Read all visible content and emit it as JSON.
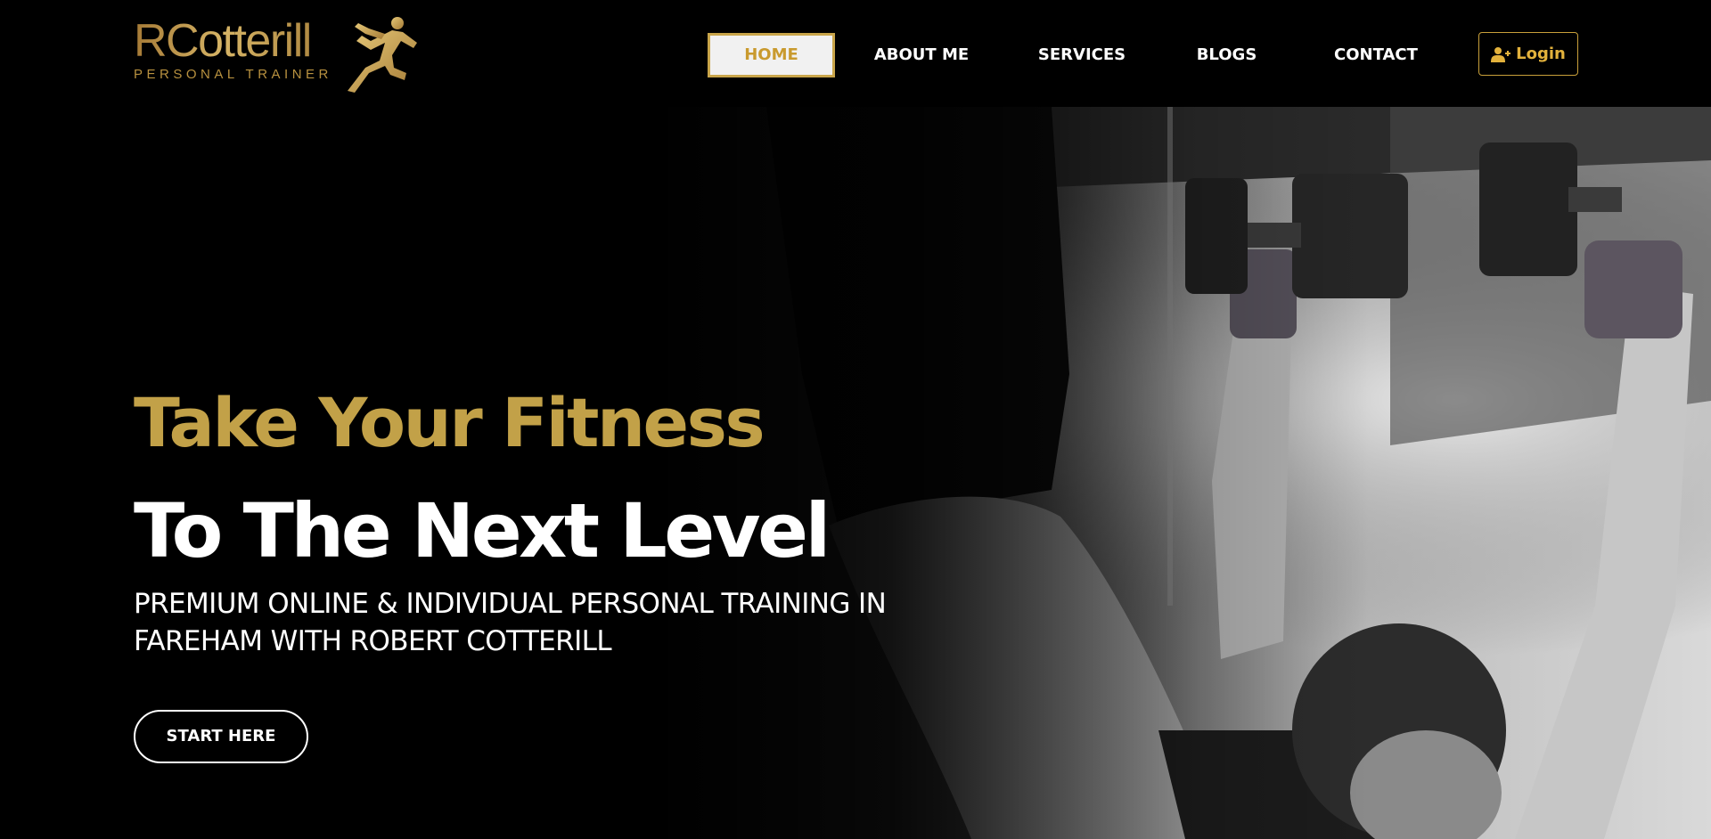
{
  "brand": {
    "name": "RCotterill",
    "tagline": "PERSONAL TRAINER",
    "logo_icon": "sprinting-runner-icon",
    "gold": "#c2a148"
  },
  "nav": {
    "items": [
      {
        "label": "HOME",
        "active": true
      },
      {
        "label": "ABOUT ME",
        "active": false
      },
      {
        "label": "SERVICES",
        "active": false
      },
      {
        "label": "BLOGS",
        "active": false
      },
      {
        "label": "CONTACT",
        "active": false
      }
    ],
    "login": {
      "label": "Login",
      "icon": "user-plus-icon",
      "color": "#e3b23c"
    }
  },
  "hero": {
    "headline_gold": "Take Your Fitness",
    "headline_white": "To The Next Level",
    "subheading": "PREMIUM ONLINE & INDIVIDUAL PERSONAL TRAINING IN FAREHAM WITH ROBERT COTTERILL",
    "cta": "START HERE",
    "background": "grayscale gym photo: trainer in black t-shirt spotting a woman lifting two dumbbells overhead"
  }
}
